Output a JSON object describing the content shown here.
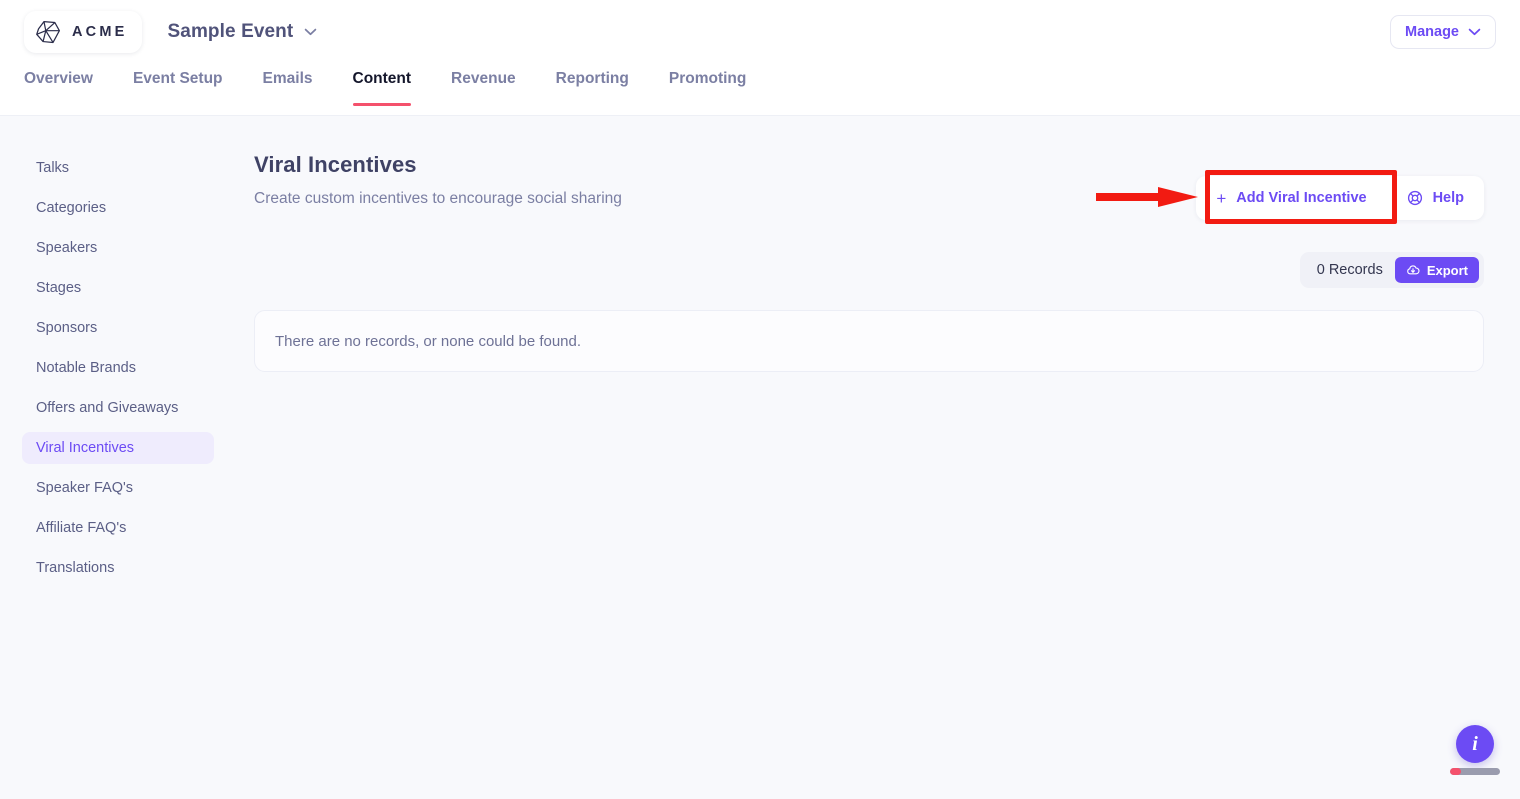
{
  "header": {
    "logo_text": "ACME",
    "logo_icon": "polyhedron-gem-icon",
    "event_name": "Sample Event",
    "event_dropdown_icon": "chevron-down-icon",
    "manage_label": "Manage",
    "manage_icon": "chevron-down-icon"
  },
  "tabs": [
    {
      "label": "Overview",
      "active": false
    },
    {
      "label": "Event Setup",
      "active": false
    },
    {
      "label": "Emails",
      "active": false
    },
    {
      "label": "Content",
      "active": true
    },
    {
      "label": "Revenue",
      "active": false
    },
    {
      "label": "Reporting",
      "active": false
    },
    {
      "label": "Promoting",
      "active": false
    }
  ],
  "sidebar": {
    "items": [
      {
        "label": "Talks",
        "active": false
      },
      {
        "label": "Categories",
        "active": false
      },
      {
        "label": "Speakers",
        "active": false
      },
      {
        "label": "Stages",
        "active": false
      },
      {
        "label": "Sponsors",
        "active": false
      },
      {
        "label": "Notable Brands",
        "active": false
      },
      {
        "label": "Offers and Giveaways",
        "active": false
      },
      {
        "label": "Viral Incentives",
        "active": true
      },
      {
        "label": "Speaker FAQ's",
        "active": false
      },
      {
        "label": "Affiliate FAQ's",
        "active": false
      },
      {
        "label": "Translations",
        "active": false
      }
    ]
  },
  "main": {
    "title": "Viral Incentives",
    "subtitle": "Create custom incentives to encourage social sharing",
    "add_button_label": "Add Viral Incentive",
    "add_button_icon": "plus-icon",
    "help_button_label": "Help",
    "help_button_icon": "lifebuoy-icon",
    "records_count_label": "0 Records",
    "export_label": "Export",
    "export_icon": "cloud-download-icon",
    "empty_message": "There are no records, or none could be found."
  },
  "widget": {
    "info_glyph": "i",
    "info_icon": "info-circle-icon"
  },
  "annotation": {
    "box_color": "#f21b12",
    "arrow_color": "#f21b12",
    "arrow_icon": "arrow-right-annotation",
    "target": "Add Viral Incentive"
  },
  "colors": {
    "accent_purple": "#6c4bf4",
    "active_tab_underline": "#f4516c",
    "page_background": "#f8f9fc",
    "header_background": "#ffffff",
    "sidebar_active_background": "#efecfd"
  }
}
